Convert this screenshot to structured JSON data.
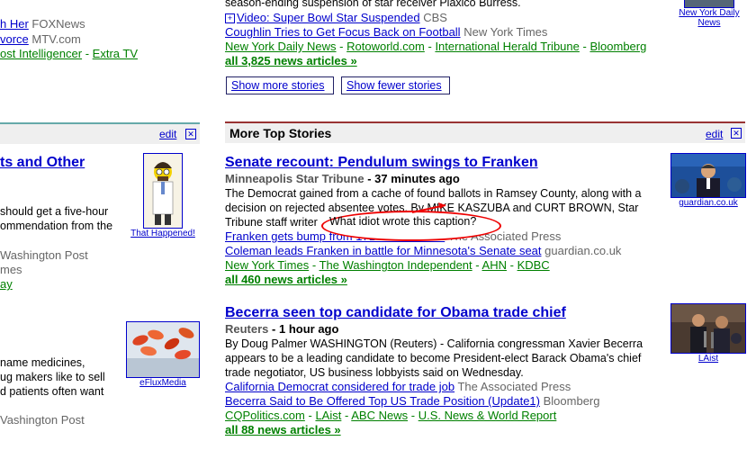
{
  "left_top": {
    "line1_link": "h Her",
    "line1_src": "FOXNews",
    "line2_link": "vorce",
    "line2_src": "MTV.com",
    "line3_link1": "ost Intelligencer",
    "line3_sep": "-",
    "line3_link2": "Extra TV"
  },
  "left_section": {
    "edit": "edit",
    "close": "✕",
    "headline": "ts and Other",
    "snippet1": "should get a five-hour",
    "snippet2": "ommendation from the",
    "src1": "Washington Post",
    "src2": "mes",
    "link3": "ay",
    "thumb1_caption": "That Happened!"
  },
  "left_story2": {
    "snippet1": "name medicines,",
    "snippet2": "ug makers like to sell",
    "snippet3": "d patients often want",
    "src": "Vashington Post",
    "thumb_caption": "eFluxMedia"
  },
  "top_story": {
    "snippet_end": "season-ending suspension of star receiver Plaxico Burress.",
    "video_link": "Video: Super Bowl Star Suspended",
    "video_src": "CBS",
    "related_link": "Coughlin Tries to Get Focus Back on Football",
    "related_src": "New York Times",
    "sources": [
      "New York Daily News",
      "Rotoworld.com",
      "International Herald Tribune",
      "Bloomberg"
    ],
    "all_articles": "all 3,825 news articles »",
    "thumb_caption": "New York Daily News"
  },
  "buttons": {
    "show_more": "Show more stories",
    "show_fewer": "Show fewer stories"
  },
  "more_top": {
    "title": "More Top Stories",
    "edit": "edit",
    "close": "✕"
  },
  "story1": {
    "headline": "Senate recount: Pendulum swings to Franken",
    "paper": "Minneapolis Star Tribune",
    "time": "- 37 minutes ago",
    "snippet_a": "The Democrat gained from a cache of found ballots in Ramsey County, along with a",
    "snippet_b": "decision on rejected absentee votes. By MIKE KASZUBA and CURT BROWN, Star",
    "snippet_c": "Tribune staff writer",
    "annotation": "What idiot wrote this caption?",
    "rel1_link": "Franken gets bump from 171 found ballots",
    "rel1_src": "The Associated Press",
    "rel2_link": "Coleman leads Franken in battle for Minnesota's Senate seat",
    "rel2_src": "guardian.co.uk",
    "sources": [
      "New York Times",
      "The Washington Independent",
      "AHN",
      "KDBC"
    ],
    "all_articles": "all 460 news articles »",
    "thumb_caption": "guardian.co.uk"
  },
  "story2": {
    "headline": "Becerra seen top candidate for Obama trade chief",
    "paper": "Reuters",
    "time": "- 1 hour ago",
    "snippet_a": "By Doug Palmer WASHINGTON (Reuters) - California congressman Xavier Becerra",
    "snippet_b": "appears to be a leading candidate to become President-elect Barack Obama's chief",
    "snippet_c": "trade negotiator, US business lobbyists said on Wednesday.",
    "rel1_link": "California Democrat considered for trade job",
    "rel1_src": "The Associated Press",
    "rel2_link": "Becerra Said to Be Offered Top US Trade Position (Update1)",
    "rel2_src": "Bloomberg",
    "sources": [
      "CQPolitics.com",
      "LAist",
      "ABC News",
      "U.S. News & World Report"
    ],
    "all_articles": "all 88 news articles »",
    "thumb_caption": "LAist"
  },
  "colors": {
    "link": "#0000cc",
    "source_green": "#008000",
    "section_border": "#993333",
    "annotation_red": "#ee0000"
  }
}
